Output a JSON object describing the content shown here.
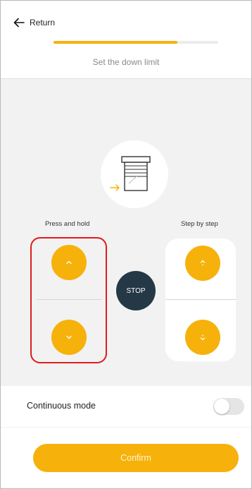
{
  "header": {
    "back_label": "Return",
    "progress_percent": 75,
    "step_title": "Set the down limit"
  },
  "controls": {
    "press_hold_label": "Press and hold",
    "step_by_step_label": "Step by step",
    "stop_label": "STOP"
  },
  "continuous": {
    "label": "Continuous mode",
    "enabled": false
  },
  "footer": {
    "confirm_label": "Confirm"
  },
  "colors": {
    "accent": "#f6b10b",
    "stop": "#243846",
    "highlight": "#e01b1b"
  },
  "icons": [
    "arrow-left-icon",
    "blind-icon",
    "chevron-up-icon",
    "chevron-down-icon",
    "step-up-icon",
    "step-down-icon"
  ]
}
